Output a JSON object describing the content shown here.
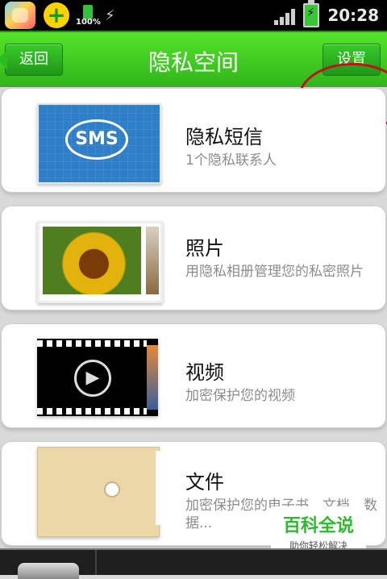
{
  "status_bar": {
    "battery_small_text": "100%",
    "time": "20:28"
  },
  "header": {
    "back_label": "返回",
    "title": "隐私空间",
    "settings_label": "设置"
  },
  "items": [
    {
      "title": "隐私短信",
      "desc": "1个隐私联系人",
      "thumb_text": "SMS"
    },
    {
      "title": "照片",
      "desc": "用隐私相册管理您的私密照片"
    },
    {
      "title": "视频",
      "desc": "加密保护您的视频"
    },
    {
      "title": "文件",
      "desc": "加密保护您的电子书、文档、数据..."
    }
  ],
  "watermark": {
    "main": "百科全说",
    "sub": "助你轻松解决"
  },
  "colors": {
    "header_green": "#2fb51a",
    "annotation_red": "#c0121b"
  }
}
